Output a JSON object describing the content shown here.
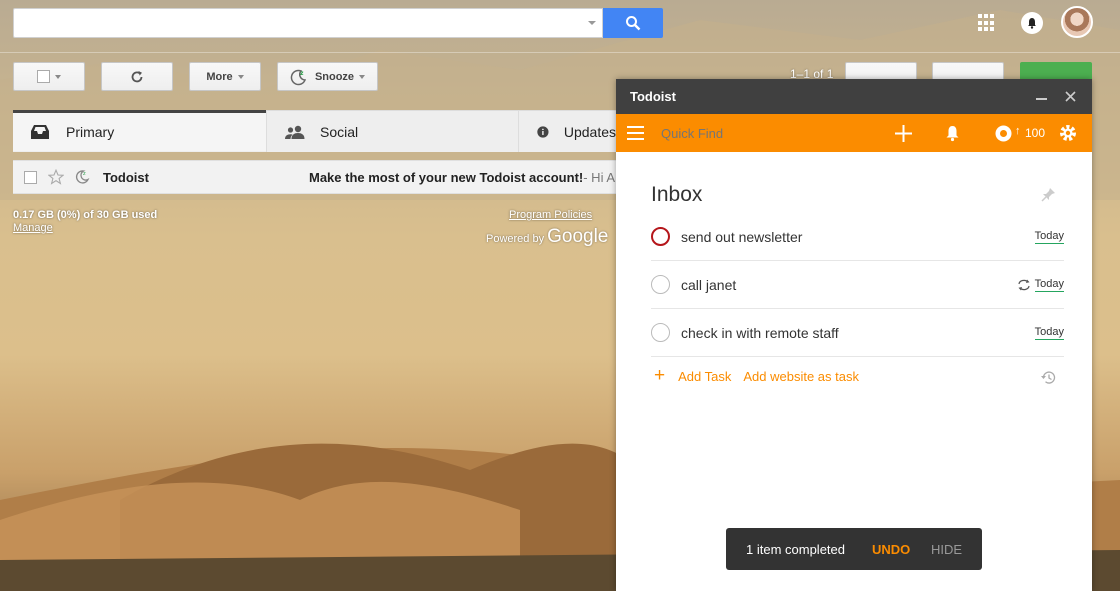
{
  "gmail": {
    "search": {
      "value": "",
      "placeholder": ""
    },
    "toolbar": {
      "more_label": "More",
      "snooze_label": "Snooze",
      "pagination": "1–1 of 1"
    },
    "tabs": [
      {
        "label": "Primary"
      },
      {
        "label": "Social"
      },
      {
        "label": "Updates"
      }
    ],
    "email": {
      "sender": "Todoist",
      "subject": "Make the most of your new Todoist account!",
      "snippet": " - Hi A"
    },
    "storage": {
      "usage": "0.17 GB (0%) of 30 GB used",
      "manage": "Manage"
    },
    "footer": {
      "program_policies": "Program Policies",
      "powered_by": "Powered by",
      "google": "Google"
    }
  },
  "todoist": {
    "title": "Todoist",
    "quick_find_placeholder": "Quick Find",
    "karma": "100",
    "project": "Inbox",
    "tasks": [
      {
        "name": "send out newsletter",
        "due": "Today",
        "recurring": false
      },
      {
        "name": "call janet",
        "due": "Today",
        "recurring": true
      },
      {
        "name": "check in with remote staff",
        "due": "Today",
        "recurring": false
      }
    ],
    "add_task": "Add Task",
    "add_website": "Add website as task",
    "toast": {
      "message": "1 item completed",
      "undo": "UNDO",
      "hide": "HIDE"
    }
  },
  "colors": {
    "accent": "#fb8c00",
    "search_blue": "#4285f4",
    "compose_green": "#4caf50",
    "priority_red": "#b5161b",
    "due_green": "#25a55f"
  }
}
